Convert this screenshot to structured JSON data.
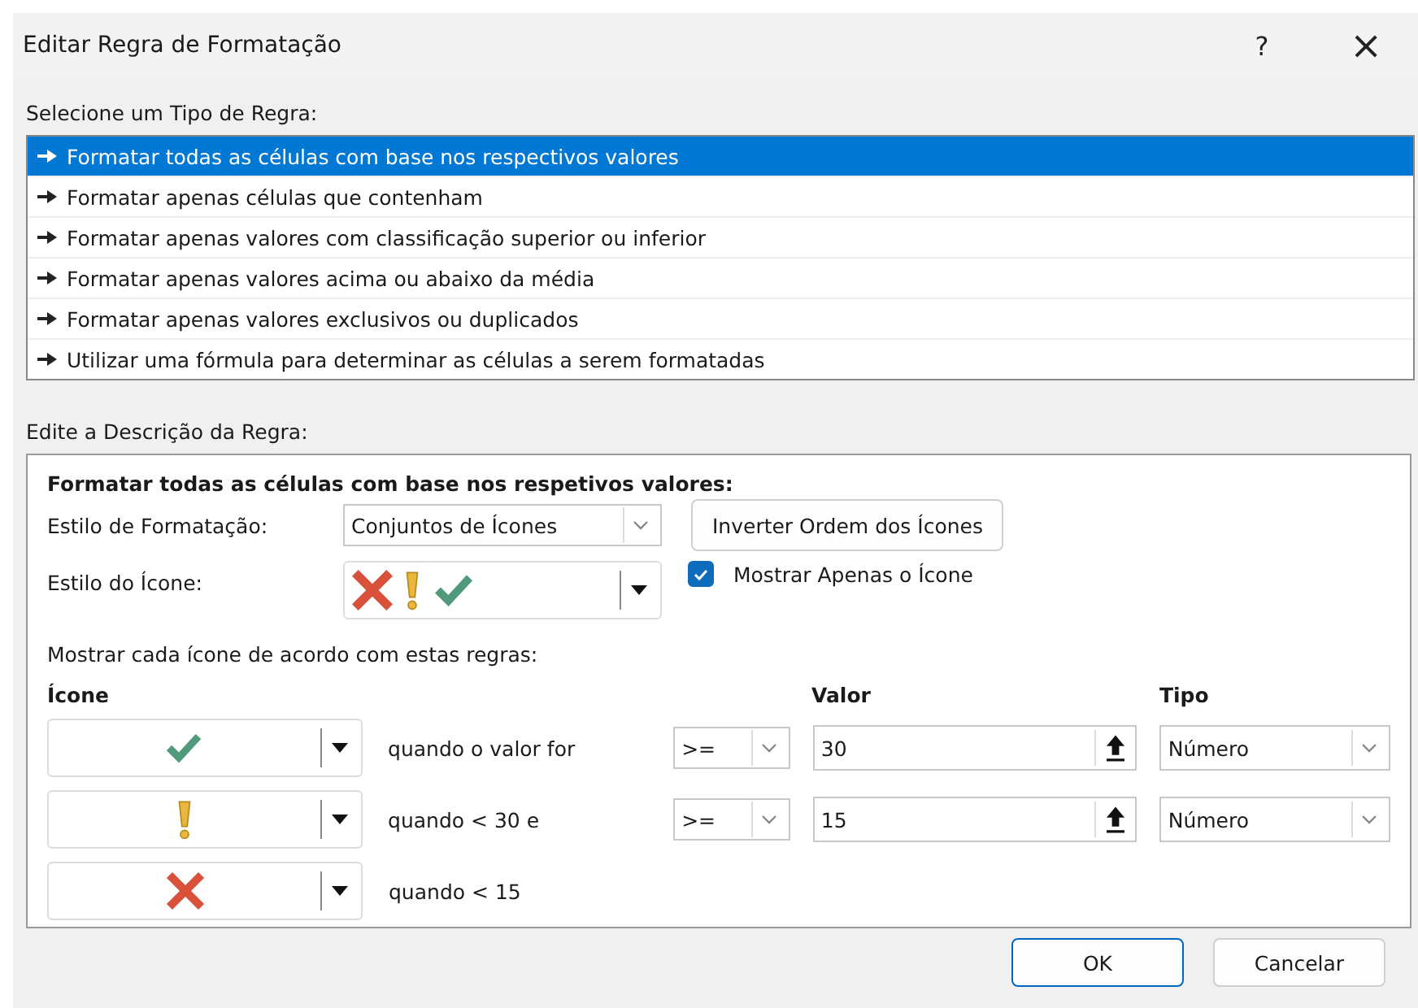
{
  "window": {
    "title": "Editar Regra de Formatação",
    "help": "?",
    "close": "×"
  },
  "rule_type": {
    "label": "Selecione um Tipo de Regra:",
    "items": [
      {
        "label": "Formatar todas as células com base nos respectivos valores",
        "selected": true
      },
      {
        "label": "Formatar apenas células que contenham",
        "selected": false
      },
      {
        "label": "Formatar apenas valores com classificação superior ou inferior",
        "selected": false
      },
      {
        "label": "Formatar apenas valores acima ou abaixo da média",
        "selected": false
      },
      {
        "label": "Formatar apenas valores exclusivos ou duplicados",
        "selected": false
      },
      {
        "label": "Utilizar uma fórmula para determinar as células a serem formatadas",
        "selected": false
      }
    ]
  },
  "description": {
    "label": "Edite a Descrição da Regra:",
    "heading": "Formatar todas as células com base nos respetivos valores:",
    "format_style": {
      "label": "Estilo de Formatação:",
      "value": "Conjuntos de Ícones"
    },
    "reverse_button": "Inverter Ordem dos Ícones",
    "icon_style": {
      "label": "Estilo do Ícone:",
      "icons": [
        {
          "kind": "cross"
        },
        {
          "kind": "warning"
        },
        {
          "kind": "check"
        }
      ]
    },
    "show_icon_only": {
      "label": "Mostrar Apenas o Ícone",
      "checked": true
    },
    "rules_label": "Mostrar cada ícone de acordo com estas regras:",
    "columns": {
      "icon": "Ícone",
      "value": "Valor",
      "type": "Tipo"
    },
    "rules": [
      {
        "kind": "check",
        "condition": "quando o valor for",
        "operator": ">=",
        "value": "30",
        "type": "Número"
      },
      {
        "kind": "warning",
        "condition": "quando < 30 e",
        "operator": ">=",
        "value": "15",
        "type": "Número"
      },
      {
        "kind": "cross",
        "condition": "quando < 15"
      }
    ]
  },
  "buttons": [
    {
      "label": "OK",
      "default": true
    },
    {
      "label": "Cancelar",
      "default": false
    }
  ]
}
